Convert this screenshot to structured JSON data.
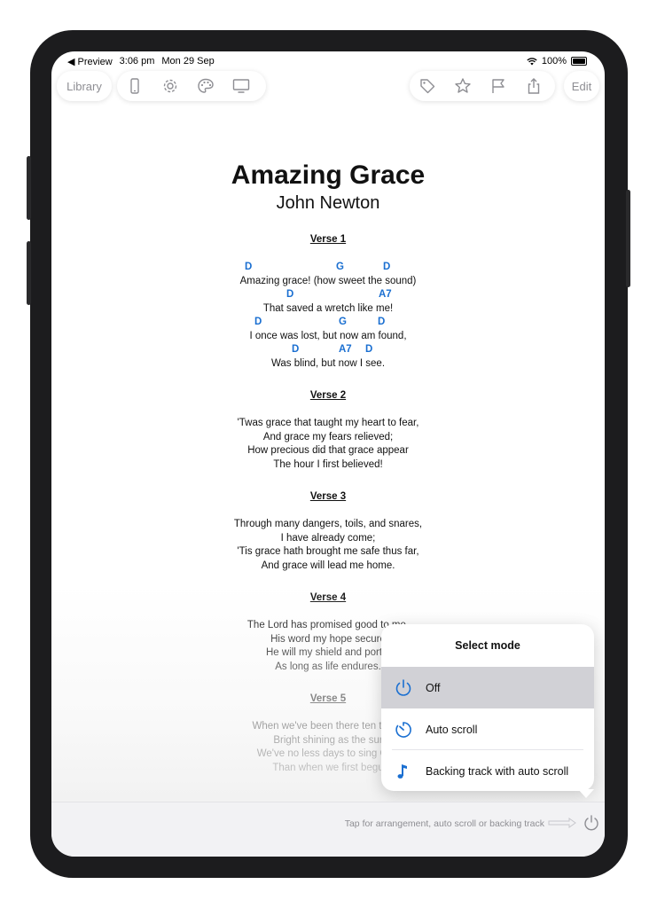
{
  "status": {
    "carrier": "◀ Preview",
    "time": "3:06 pm",
    "date": "Mon 29 Sep",
    "battery": "100%"
  },
  "toolbar": {
    "library": "Library",
    "edit": "Edit",
    "left_icons": [
      "phone-icon",
      "gear-icon",
      "palette-icon",
      "monitor-icon"
    ],
    "right_icons": [
      "tag-icon",
      "star-icon",
      "flag-icon",
      "share-icon"
    ]
  },
  "song": {
    "title": "Amazing Grace",
    "author": "John Newton",
    "verses": [
      {
        "heading": "Verse 1"
      },
      {
        "heading": "Verse 2"
      },
      {
        "heading": "Verse 3"
      },
      {
        "heading": "Verse 4"
      },
      {
        "heading": "Verse 5"
      }
    ],
    "verse1": {
      "chords": [
        [
          "D",
          "G",
          "D"
        ],
        [
          "D",
          "A7"
        ],
        [
          "D",
          "G",
          "D"
        ],
        [
          "D",
          "A7",
          "D"
        ]
      ],
      "lines": [
        "Amazing grace! (how sweet the sound)",
        "That saved a wretch like me!",
        "I once was lost, but now am found,",
        "Was blind, but now I see."
      ]
    },
    "verse2": [
      "'Twas grace that taught my heart to fear,",
      "And grace my fears relieved;",
      "How precious did that grace appear",
      "The hour I first believed!"
    ],
    "verse3": [
      "Through many dangers, toils, and snares,",
      "I have already come;",
      "'Tis grace hath brought me safe thus far,",
      "And grace will lead me home."
    ],
    "verse4": [
      "The Lord has promised good to me.",
      "His word my hope secure",
      "He will my shield and portio",
      "As long as life endures."
    ],
    "verse5": [
      "When we've been there ten thous",
      "Bright shining as the sur",
      "We've no less days to sing God",
      "Than when we first begu"
    ]
  },
  "popup": {
    "title": "Select mode",
    "options": [
      {
        "label": "Off",
        "icon": "power-icon",
        "selected": true
      },
      {
        "label": "Auto scroll",
        "icon": "timer-icon",
        "selected": false
      },
      {
        "label": "Backing track with auto scroll",
        "icon": "music-note-icon",
        "selected": false
      }
    ]
  },
  "bottom": {
    "hint": "Tap for arrangement, auto scroll or backing track"
  },
  "colors": {
    "accent": "#1a6fd1",
    "chord": "#1a6fd1",
    "selected_row": "#d1d1d6"
  }
}
